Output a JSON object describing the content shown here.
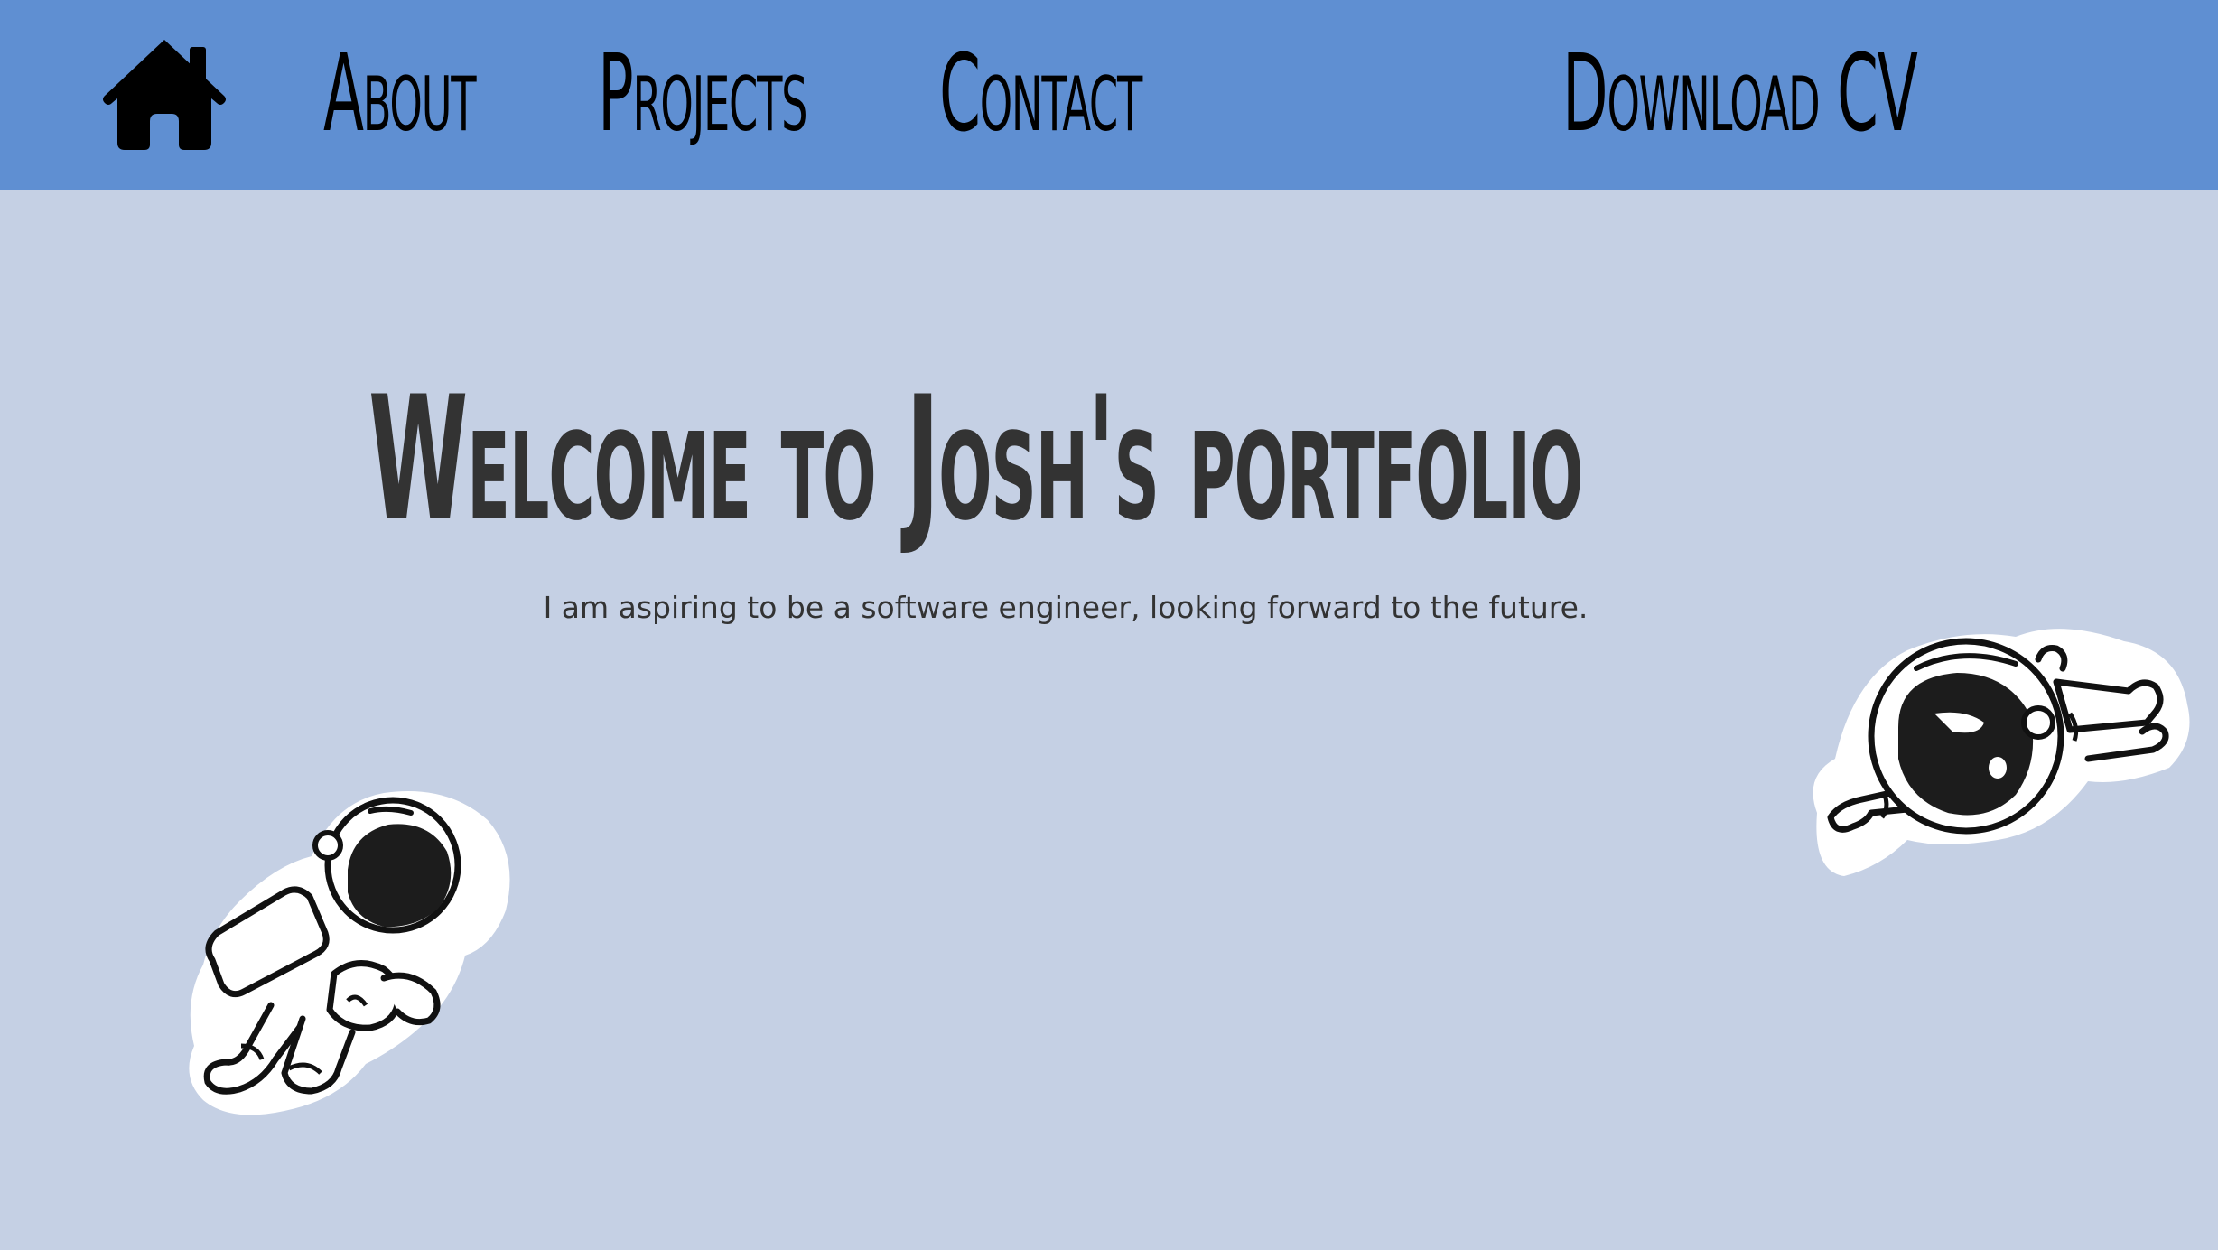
{
  "nav": {
    "home_icon": "home-icon",
    "about_label": "About",
    "projects_label": "Projects",
    "contact_label": "Contact",
    "cv_label": "Download CV"
  },
  "hero": {
    "title": "Welcome to Josh's portfolio",
    "tagline": "I am aspiring to be a software engineer, looking forward to the future."
  },
  "illustrations": {
    "left": "astronaut-sticker",
    "right": "astronaut-sticker"
  },
  "colors": {
    "topbar": "#5f8fd2",
    "background": "#c5d0e4",
    "text": "#333333",
    "nav_text": "#000000"
  }
}
